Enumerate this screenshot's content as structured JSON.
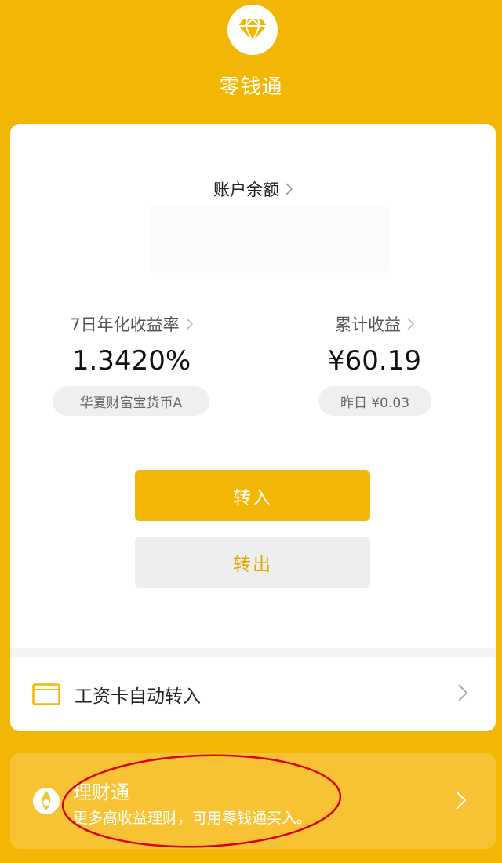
{
  "header": {
    "title": "零钱通",
    "logo_icon": "diamond-icon"
  },
  "balance": {
    "label": "账户余额"
  },
  "stats": {
    "yield": {
      "label": "7日年化收益率",
      "value": "1.3420%",
      "fund": "华夏财富宝货币A"
    },
    "earnings": {
      "label": "累计收益",
      "value": "¥60.19",
      "yesterday": "昨日 ¥0.03"
    }
  },
  "actions": {
    "transfer_in": "转入",
    "transfer_out": "转出"
  },
  "salary_row": {
    "label": "工资卡自动转入",
    "icon": "card-icon"
  },
  "licai": {
    "title": "理财通",
    "subtitle": "更多高收益理财，可用零钱通买入。",
    "icon": "licai-logo-icon"
  },
  "colors": {
    "brand": "#F2B705",
    "annotation": "#D90000"
  }
}
